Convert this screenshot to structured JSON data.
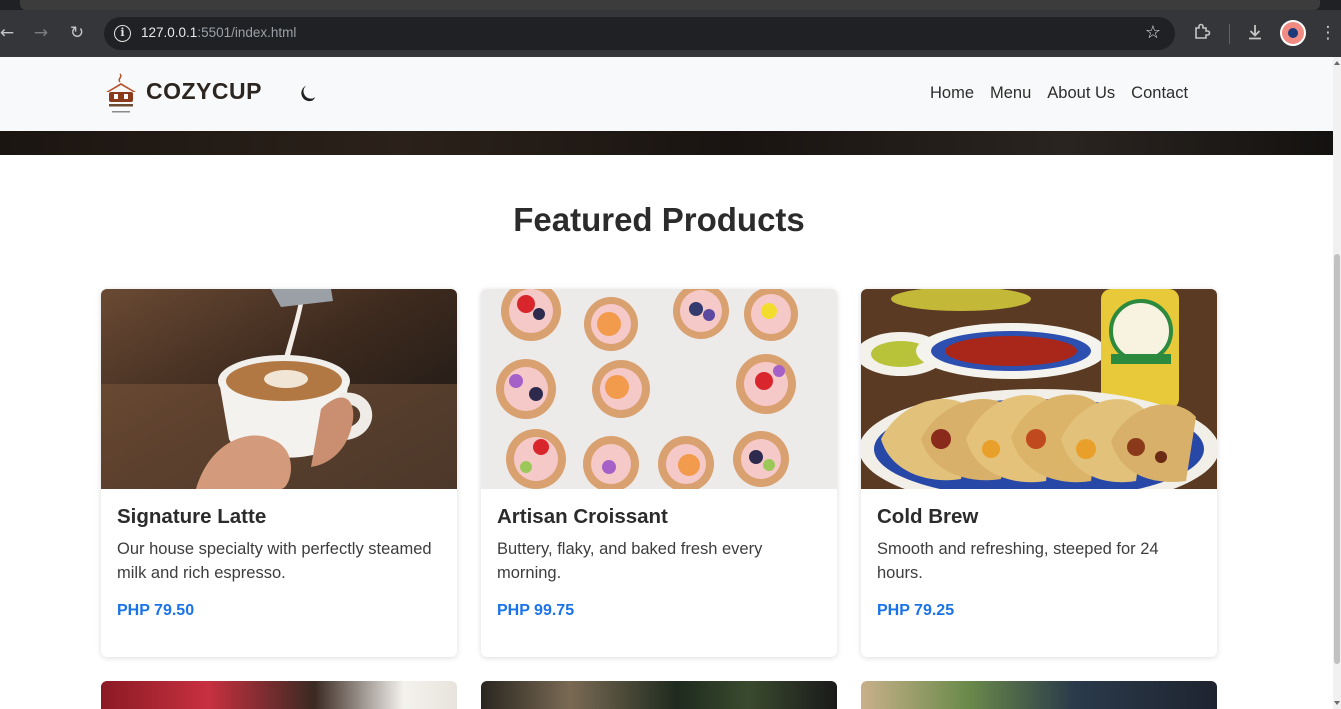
{
  "browser": {
    "url_host": "127.0.0.1",
    "url_rest": ":5501/index.html",
    "icons": {
      "back": "back-arrow-icon",
      "forward": "forward-arrow-icon",
      "reload": "reload-icon",
      "info": "site-info-icon",
      "bookmark": "bookmark-star-icon",
      "extensions": "extensions-icon",
      "download": "download-icon",
      "menu": "kebab-menu-icon"
    }
  },
  "navbar": {
    "brand": "COZYCUP",
    "links": [
      "Home",
      "Menu",
      "About Us",
      "Contact"
    ]
  },
  "featured": {
    "title": "Featured Products",
    "products": [
      {
        "name": "Signature Latte",
        "description": "Our house specialty with perfectly steamed milk and rich espresso.",
        "price": "PHP 79.50"
      },
      {
        "name": "Artisan Croissant",
        "description": "Buttery, flaky, and baked fresh every morning.",
        "price": "PHP 99.75"
      },
      {
        "name": "Cold Brew",
        "description": "Smooth and refreshing, steeped for 24 hours.",
        "price": "PHP 79.25"
      }
    ]
  },
  "colors": {
    "price": "#1a73e8",
    "brand_text": "#2d2620",
    "navbar_bg": "#f8f9fa"
  }
}
